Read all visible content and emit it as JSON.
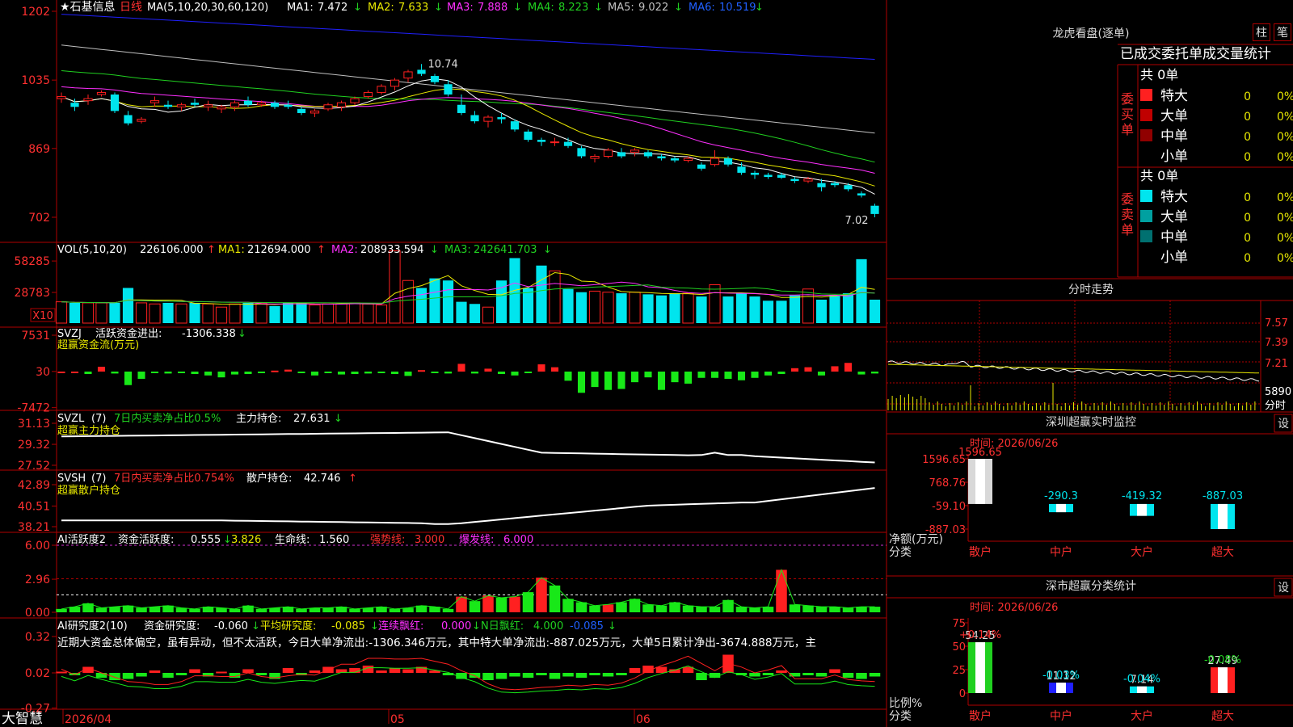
{
  "app": {
    "brand": "大智慧"
  },
  "colors": {
    "up": "#ff2020",
    "down": "#00e5ee",
    "grid": "#b00000",
    "bg": "#000000",
    "ma1": "#ffffff",
    "ma2": "#e8e800",
    "ma3": "#ff30ff",
    "ma4": "#20d020",
    "ma5": "#c0c0c0",
    "ma6": "#2020ff"
  },
  "kline": {
    "title_prefix": "★石基信息",
    "period": "日线",
    "ma_params": "MA(5,10,20,30,60,120)",
    "ma_values": [
      {
        "label": "MA1:",
        "value": "7.472",
        "arrow": "↓"
      },
      {
        "label": "MA2:",
        "value": "7.633",
        "arrow": "↓"
      },
      {
        "label": "MA3:",
        "value": "7.888",
        "arrow": "↓"
      },
      {
        "label": "MA4:",
        "value": "8.223",
        "arrow": "↓"
      },
      {
        "label": "MA5:",
        "value": "9.022",
        "arrow": "↓"
      },
      {
        "label": "MA6:",
        "value": "10.519",
        "arrow": "↓"
      }
    ],
    "y_ticks": [
      "1202",
      "1035",
      "869",
      "702"
    ],
    "high_label": "10.74",
    "low_label": "7.02",
    "candles": [
      [
        9.9,
        10.05,
        9.8,
        9.95
      ],
      [
        9.8,
        9.9,
        9.6,
        9.7
      ],
      [
        9.85,
        10.0,
        9.75,
        9.9
      ],
      [
        10.0,
        10.1,
        9.95,
        10.05
      ],
      [
        10.0,
        10.05,
        9.55,
        9.6
      ],
      [
        9.5,
        9.6,
        9.25,
        9.3
      ],
      [
        9.35,
        9.45,
        9.3,
        9.4
      ],
      [
        9.8,
        9.95,
        9.7,
        9.85
      ],
      [
        9.75,
        9.85,
        9.65,
        9.7
      ],
      [
        9.7,
        9.8,
        9.6,
        9.75
      ],
      [
        9.8,
        9.9,
        9.7,
        9.75
      ],
      [
        9.7,
        9.85,
        9.6,
        9.75
      ],
      [
        9.65,
        9.75,
        9.55,
        9.7
      ],
      [
        9.7,
        9.85,
        9.6,
        9.8
      ],
      [
        9.85,
        9.95,
        9.7,
        9.75
      ],
      [
        9.75,
        9.85,
        9.7,
        9.8
      ],
      [
        9.8,
        9.85,
        9.65,
        9.7
      ],
      [
        9.75,
        9.85,
        9.65,
        9.7
      ],
      [
        9.65,
        9.7,
        9.5,
        9.55
      ],
      [
        9.55,
        9.65,
        9.45,
        9.6
      ],
      [
        9.65,
        9.8,
        9.6,
        9.75
      ],
      [
        9.7,
        9.85,
        9.6,
        9.8
      ],
      [
        9.8,
        9.95,
        9.75,
        9.9
      ],
      [
        9.95,
        10.1,
        9.9,
        10.05
      ],
      [
        10.05,
        10.25,
        10.0,
        10.2
      ],
      [
        10.2,
        10.4,
        10.1,
        10.35
      ],
      [
        10.4,
        10.6,
        10.3,
        10.55
      ],
      [
        10.6,
        10.74,
        10.45,
        10.5
      ],
      [
        10.45,
        10.5,
        10.25,
        10.3
      ],
      [
        10.25,
        10.35,
        9.95,
        10.0
      ],
      [
        9.75,
        10.0,
        9.5,
        9.55
      ],
      [
        9.5,
        9.6,
        9.3,
        9.35
      ],
      [
        9.35,
        9.5,
        9.2,
        9.45
      ],
      [
        9.45,
        9.55,
        9.3,
        9.4
      ],
      [
        9.35,
        9.4,
        9.1,
        9.15
      ],
      [
        9.1,
        9.15,
        8.85,
        8.9
      ],
      [
        8.9,
        8.95,
        8.75,
        8.85
      ],
      [
        8.85,
        8.95,
        8.75,
        8.85
      ],
      [
        8.85,
        8.95,
        8.7,
        8.75
      ],
      [
        8.7,
        8.75,
        8.45,
        8.5
      ],
      [
        8.45,
        8.55,
        8.35,
        8.5
      ],
      [
        8.5,
        8.7,
        8.45,
        8.65
      ],
      [
        8.6,
        8.7,
        8.45,
        8.5
      ],
      [
        8.6,
        8.7,
        8.5,
        8.65
      ],
      [
        8.6,
        8.65,
        8.45,
        8.5
      ],
      [
        8.5,
        8.55,
        8.4,
        8.45
      ],
      [
        8.45,
        8.5,
        8.35,
        8.4
      ],
      [
        8.4,
        8.5,
        8.35,
        8.45
      ],
      [
        8.3,
        8.35,
        8.15,
        8.2
      ],
      [
        8.3,
        8.65,
        8.25,
        8.45
      ],
      [
        8.45,
        8.5,
        8.25,
        8.3
      ],
      [
        8.25,
        8.35,
        8.05,
        8.1
      ],
      [
        8.1,
        8.15,
        7.95,
        8.05
      ],
      [
        8.05,
        8.1,
        7.95,
        8.0
      ],
      [
        8.05,
        8.1,
        7.95,
        7.98
      ],
      [
        7.95,
        8.0,
        7.85,
        7.9
      ],
      [
        7.9,
        8.0,
        7.85,
        7.95
      ],
      [
        7.85,
        7.95,
        7.65,
        7.75
      ],
      [
        7.85,
        7.9,
        7.75,
        7.8
      ],
      [
        7.8,
        7.85,
        7.65,
        7.7
      ],
      [
        7.6,
        7.65,
        7.5,
        7.55
      ],
      [
        7.3,
        7.35,
        7.02,
        7.1
      ]
    ]
  },
  "volume": {
    "label": "VOL(5,10,20)",
    "value": "226106.000",
    "value_arrow": "↑",
    "ma_values": [
      {
        "label": "MA1:",
        "value": "212694.000",
        "arrow": "↑"
      },
      {
        "label": "MA2:",
        "value": "208933.594",
        "arrow": "↓"
      },
      {
        "label": "MA3:",
        "value": "242641.703",
        "arrow": "↓"
      }
    ],
    "y_ticks": [
      "58285",
      "28783"
    ],
    "unit_tag": "X10",
    "bars": [
      20000,
      19000,
      19000,
      19000,
      19000,
      33000,
      19000,
      18000,
      19000,
      18000,
      19000,
      18000,
      15000,
      18000,
      19000,
      19000,
      16000,
      19000,
      19000,
      17000,
      18000,
      18000,
      19000,
      18000,
      17000,
      68000,
      40000,
      33000,
      42000,
      40000,
      20000,
      18000,
      15000,
      40000,
      61000,
      33000,
      54000,
      49000,
      32000,
      29000,
      30000,
      29000,
      28000,
      29000,
      27000,
      26000,
      28000,
      28000,
      25000,
      36000,
      25000,
      28000,
      25000,
      21000,
      21000,
      26000,
      32000,
      22000,
      26000,
      28000,
      60000,
      22000,
      30000,
      28000,
      25000,
      24000,
      20000,
      20000,
      22000,
      23000,
      24000,
      26000,
      30000
    ]
  },
  "svzj": {
    "label": "SVZJ",
    "text1": "活跃资金进出:",
    "value1": "-1306.338",
    "arrow1": "↓",
    "text2": "超赢资金流(万元)",
    "y_ticks": [
      "7531",
      "30",
      "-7472"
    ]
  },
  "svzl": {
    "label": "SVZL",
    "param": "(7)",
    "text1": "7日内买卖净占比0.5%",
    "text2": "主力持仓:",
    "value2": "27.631",
    "arrow2": "↓",
    "text3": "超赢主力持仓",
    "y_ticks": [
      "31.13",
      "29.32",
      "27.52"
    ]
  },
  "svsh": {
    "label": "SVSH",
    "param": "(7)",
    "text1": "7日内买卖净占比0.754%",
    "text2": "散户持仓:",
    "value2": "42.746",
    "arrow2": "↑",
    "text3": "超赢散户持仓",
    "y_ticks": [
      "42.89",
      "40.51",
      "38.21"
    ]
  },
  "ai_active": {
    "label": "AI活跃度2",
    "text1": "资金活跃度:",
    "value1": "0.555",
    "arrow1": "↓",
    "value2": "3.826",
    "text3": "生命线:",
    "value3": "1.560",
    "text4": "强势线:",
    "value4": "3.000",
    "text5": "爆发线:",
    "value5": "6.000",
    "y_ticks": [
      "6.00",
      "2.96",
      "0.00"
    ]
  },
  "ai_research": {
    "label": "AI研究度2(10)",
    "text1": "资金研究度:",
    "value1": "-0.060",
    "arrow1": "↓",
    "text2": "平均研究度:",
    "value2": "-0.085",
    "arrow2": "↓",
    "text3": "连续飘红:",
    "value3": "0.000",
    "arrow3": "↓",
    "text4": "N日飘红:",
    "value4": "4.000",
    "value5": "-0.085",
    "arrow5": "↓",
    "summary": "近期大资金总体偏空，虽有异动，但不太活跃，今日大单净流出:-1306.346万元，其中特大单净流出:-887.025万元，大单5日累计净出-3674.888万元，主",
    "y_ticks": [
      "0.32",
      "0.02",
      "-0.27"
    ]
  },
  "x_axis": {
    "labels": [
      "2026/04",
      "05",
      "06"
    ]
  },
  "dragon": {
    "title": "龙虎看盘(逐单)",
    "btn_pillar": "柱",
    "btn_order": "笔",
    "subtitle": "已成交委托单成交量统计",
    "buy_side_label": "委买单",
    "sell_side_label": "委卖单",
    "buy_total": "共 0单",
    "sell_total": "共 0单",
    "buy_rows": [
      {
        "name": "特大",
        "count": "0",
        "pct": "0%"
      },
      {
        "name": "大单",
        "count": "0",
        "pct": "0%"
      },
      {
        "name": "中单",
        "count": "0",
        "pct": "0%"
      },
      {
        "name": "小单",
        "count": "0",
        "pct": "0%"
      }
    ],
    "sell_rows": [
      {
        "name": "特大",
        "count": "0",
        "pct": "0%"
      },
      {
        "name": "大单",
        "count": "0",
        "pct": "0%"
      },
      {
        "name": "中单",
        "count": "0",
        "pct": "0%"
      },
      {
        "name": "小单",
        "count": "0",
        "pct": "0%"
      }
    ]
  },
  "intraday": {
    "title": "分时走势",
    "y_ticks": [
      "7.57",
      "7.39",
      "7.21"
    ],
    "vol_tick": "5890",
    "vol_unit": "分时"
  },
  "chart_data": [
    {
      "type": "bar",
      "title": "深圳超赢实时监控",
      "settings_label": "设",
      "time_label": "时间: 2026/06/26",
      "ylabel": "净额(万元)",
      "xlabel": "分类",
      "y_ticks": [
        "1596.65",
        "768.76",
        "-59.10",
        "-887.03"
      ],
      "ylim": [
        -887.03,
        1596.65
      ],
      "categories": [
        "散户",
        "中户",
        "大户",
        "超大"
      ],
      "values": [
        1596.65,
        -290.3,
        -419.32,
        -887.03
      ],
      "value_labels": [
        "1596.65",
        "-290.3",
        "-419.32",
        "-887.03"
      ]
    },
    {
      "type": "bar",
      "title": "深市超赢分类统计",
      "settings_label": "设",
      "time_label": "时间: 2026/06/26",
      "ylabel": "比例%",
      "xlabel": "分类",
      "y_ticks": [
        "75",
        "50",
        "25",
        "0"
      ],
      "ylim": [
        0,
        75
      ],
      "categories": [
        "散户",
        "中户",
        "大户",
        "超大"
      ],
      "values": [
        54.25,
        11.12,
        7.14,
        27.49
      ],
      "value_labels": [
        "54.25",
        "11.12",
        "7.14",
        "27.49"
      ],
      "change_labels": [
        "+0.14%",
        "-0.03%",
        "-0.04%",
        "-0.08%"
      ]
    }
  ]
}
